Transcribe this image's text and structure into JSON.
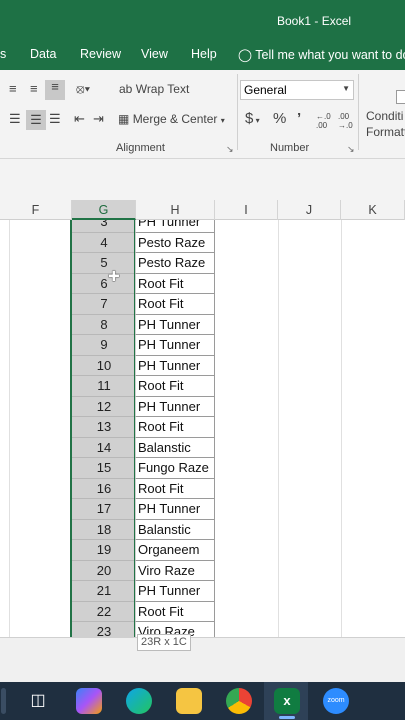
{
  "window": {
    "title": "Book1  -  Excel"
  },
  "menu": {
    "items": [
      "s",
      "Data",
      "Review",
      "View",
      "Help"
    ],
    "tellme": "Tell me what you want to do"
  },
  "ribbon": {
    "wrap_text": "Wrap Text",
    "merge_center": "Merge & Center",
    "number_format": "General",
    "currency": "$",
    "percent": "%",
    "comma": "’",
    "inc_decimal": "←.0 .00",
    "dec_decimal": ".00 →.0",
    "conditional_line1": "Conditi",
    "conditional_line2": "Formatt",
    "alignment_label": "Alignment",
    "number_label": "Number"
  },
  "columns": [
    "F",
    "G",
    "H",
    "I",
    "J",
    "K"
  ],
  "rows": [
    {
      "g": "3",
      "h": "PH Tunner"
    },
    {
      "g": "4",
      "h": "Pesto Raze"
    },
    {
      "g": "5",
      "h": "Pesto Raze"
    },
    {
      "g": "6",
      "h": "Root Fit"
    },
    {
      "g": "7",
      "h": "Root Fit"
    },
    {
      "g": "8",
      "h": "PH Tunner"
    },
    {
      "g": "9",
      "h": "PH Tunner"
    },
    {
      "g": "10",
      "h": "PH Tunner"
    },
    {
      "g": "11",
      "h": "Root Fit"
    },
    {
      "g": "12",
      "h": "PH Tunner"
    },
    {
      "g": "13",
      "h": "Root Fit"
    },
    {
      "g": "14",
      "h": "Balanstic"
    },
    {
      "g": "15",
      "h": "Fungo Raze"
    },
    {
      "g": "16",
      "h": "Root Fit"
    },
    {
      "g": "17",
      "h": "PH Tunner"
    },
    {
      "g": "18",
      "h": "Balanstic"
    },
    {
      "g": "19",
      "h": "Organeem"
    },
    {
      "g": "20",
      "h": "Viro Raze"
    },
    {
      "g": "21",
      "h": "PH Tunner"
    },
    {
      "g": "22",
      "h": "Root Fit"
    },
    {
      "g": "23",
      "h": "Viro Raze"
    }
  ],
  "selection_tooltip": "23R x 1C",
  "taskbar": {
    "icons": [
      "task-view-icon",
      "copilot-icon",
      "edge-icon",
      "file-explorer-icon",
      "chrome-icon",
      "excel-icon",
      "zoom-icon"
    ],
    "zoom_label": "zoom"
  },
  "colors": {
    "accent": "#1e7145",
    "selection": "#217346"
  }
}
